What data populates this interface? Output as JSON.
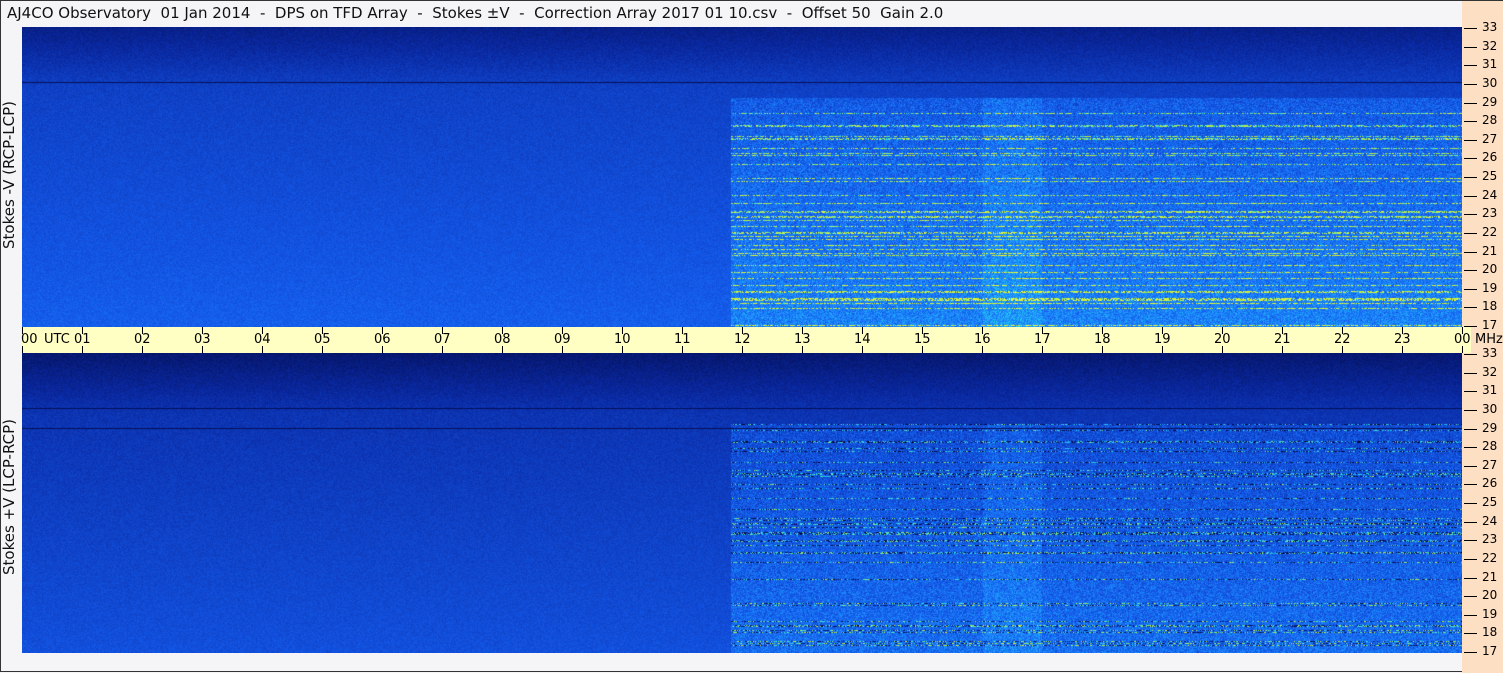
{
  "title": "AJ4CO Observatory  01 Jan 2014  -  DPS on TFD Array  -  Stokes ±V  -  Correction Array 2017 01 10.csv  -  Offset 50  Gain 2.0",
  "chart_data": {
    "type": "heatmap",
    "title": "AJ4CO Observatory  01 Jan 2014  -  DPS on TFD Array  -  Stokes ±V  -  Correction Array 2017 01 10.csv  -  Offset 50  Gain 2.0",
    "xlabel": "UTC",
    "x_ticks": [
      "00",
      "01",
      "02",
      "03",
      "04",
      "05",
      "06",
      "07",
      "08",
      "09",
      "10",
      "11",
      "12",
      "13",
      "14",
      "15",
      "16",
      "17",
      "18",
      "19",
      "20",
      "21",
      "22",
      "23",
      "00"
    ],
    "x_unit": "UTC",
    "ylabel_unit": "MHz",
    "y_ticks": [
      33,
      32,
      31,
      30,
      29,
      28,
      27,
      26,
      25,
      24,
      23,
      22,
      21,
      20,
      19,
      18,
      17
    ],
    "ylim": [
      17,
      33
    ],
    "xlim": [
      0,
      24
    ],
    "panels": [
      {
        "name": "Stokes -V (RCP-LCP)",
        "activity_start_hour": 11.8
      },
      {
        "name": "Stokes +V (LCP-RCP)",
        "activity_start_hour": 11.8
      }
    ]
  }
}
